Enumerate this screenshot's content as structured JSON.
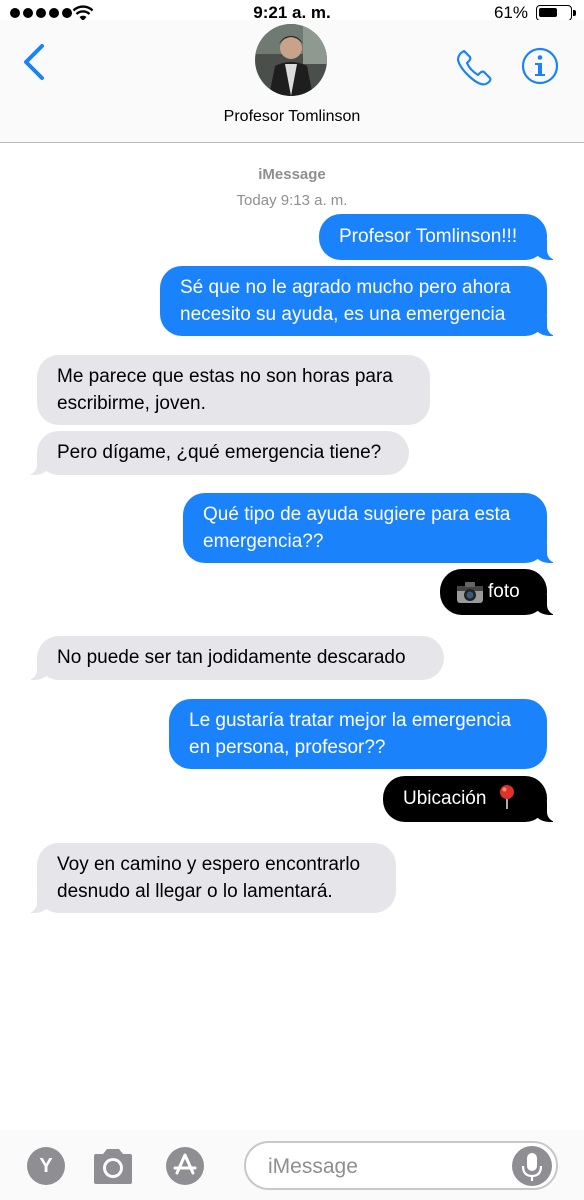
{
  "status_bar": {
    "time": "9:21 a. m.",
    "battery_percent": "61%",
    "battery_level": 0.61,
    "signal_bars": 5
  },
  "header": {
    "contact_name": "Profesor Tomlinson",
    "back_icon": "chevron-left-icon",
    "call_icon": "phone-icon",
    "info_icon": "info-icon"
  },
  "thread": {
    "service_label": "iMessage",
    "timestamp": "Today 9:13 a. m.",
    "messages": [
      {
        "from": "me",
        "text": "Profesor Tomlinson!!!"
      },
      {
        "from": "me",
        "lines": [
          "Sé que no le agrado mucho pero ahora",
          "necesito su ayuda, es una emergencia"
        ]
      },
      {
        "from": "them",
        "lines": [
          "Me parece que estas no son horas para",
          "escribirme, joven."
        ]
      },
      {
        "from": "them",
        "text": "Pero dígame, ¿qué emergencia tiene?"
      },
      {
        "from": "me",
        "lines": [
          "Qué tipo de ayuda sugiere para esta",
          "emergencia??"
        ]
      },
      {
        "from": "me",
        "style": "dark",
        "text": "foto",
        "icon": "camera-emoji"
      },
      {
        "from": "them",
        "text": "No puede ser tan jodidamente descarado"
      },
      {
        "from": "me",
        "lines": [
          "Le gustaría tratar mejor la emergencia",
          "en persona, profesor??"
        ]
      },
      {
        "from": "me",
        "style": "dark",
        "text": "Ubicación",
        "icon": "pushpin-emoji"
      },
      {
        "from": "them",
        "lines": [
          "Voy en camino y espero encontrarlo",
          "desnudo al llegar o lo lamentará."
        ]
      }
    ]
  },
  "toolbar": {
    "app_button_letter": "Y",
    "input_placeholder": "iMessage",
    "colors": {
      "sent": "#1a82fb",
      "received": "#e5e5ea",
      "accent": "#1a82fb"
    }
  }
}
